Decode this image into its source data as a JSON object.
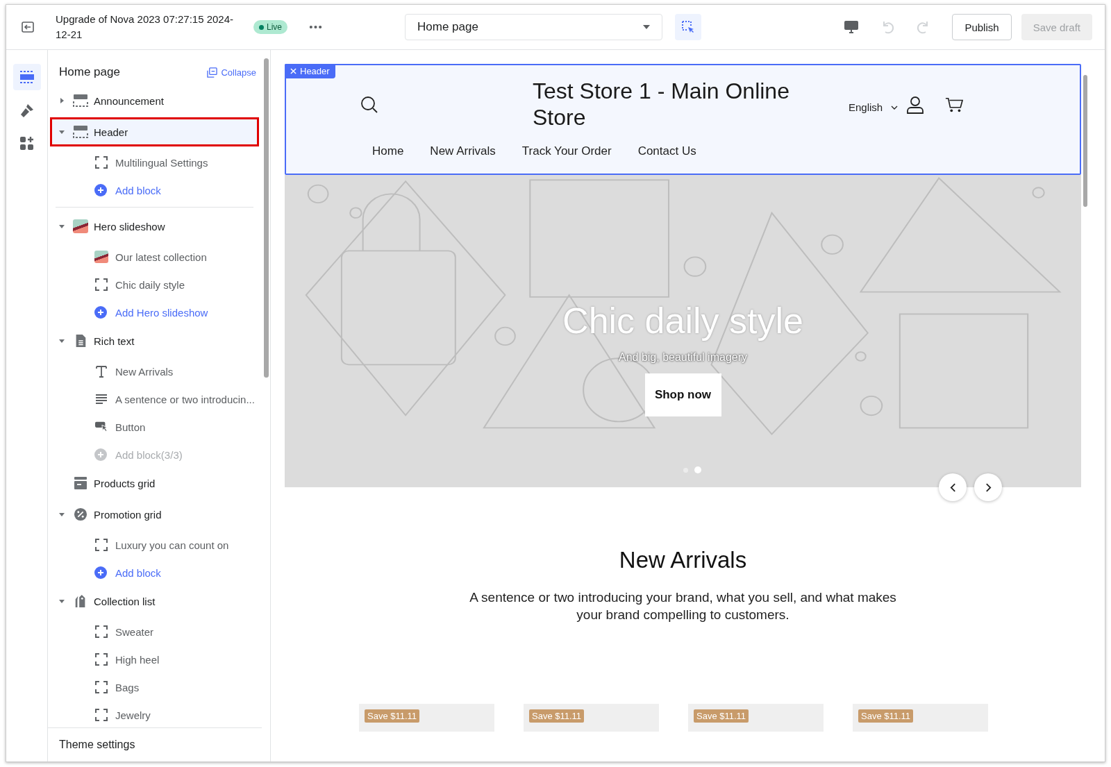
{
  "toolbar": {
    "title": "Upgrade of Nova 2023 07:27:15 2024-12-21",
    "status": "Live",
    "page_select": {
      "value": "Home page"
    },
    "inspect": {
      "selected": true
    },
    "undo": {
      "disabled": true
    },
    "redo": {
      "disabled": true
    },
    "publish": "Publish",
    "save_draft": {
      "label": "Save draft",
      "disabled": true
    }
  },
  "rail": [
    {
      "selected": true
    },
    {
      "selected": false
    },
    {
      "selected": false
    }
  ],
  "sidebar": {
    "title": "Home page",
    "collapse": "Collapse",
    "footer": "Theme settings",
    "sections": [
      {
        "label": "Announcement",
        "kind": "layout",
        "expanded": false,
        "selected": false
      },
      {
        "label": "Header",
        "kind": "layout",
        "expanded": true,
        "selected": true,
        "children": [
          {
            "label": "Multilingual Settings",
            "kind": "frame"
          },
          {
            "label": "Add block",
            "kind": "add",
            "disabled": false
          }
        ]
      },
      {
        "label": "Hero slideshow",
        "kind": "image",
        "expanded": true,
        "selected": false,
        "children": [
          {
            "label": "Our latest collection",
            "kind": "image"
          },
          {
            "label": "Chic daily style",
            "kind": "frame"
          },
          {
            "label": "Add Hero slideshow",
            "kind": "add",
            "disabled": false
          }
        ]
      },
      {
        "label": "Rich text",
        "kind": "document",
        "expanded": true,
        "selected": false,
        "children": [
          {
            "label": "New Arrivals",
            "kind": "text"
          },
          {
            "label": "A sentence or two introducin...",
            "kind": "lines"
          },
          {
            "label": "Button",
            "kind": "button"
          },
          {
            "label": "Add block(3/3)",
            "kind": "add",
            "disabled": true
          }
        ]
      },
      {
        "label": "Products grid",
        "kind": "archive",
        "selected": false
      },
      {
        "label": "Promotion grid",
        "kind": "percent",
        "expanded": true,
        "selected": false,
        "children": [
          {
            "label": "Luxury you can count on",
            "kind": "frame"
          },
          {
            "label": "Add block",
            "kind": "add",
            "disabled": false
          }
        ]
      },
      {
        "label": "Collection list",
        "kind": "tag",
        "expanded": true,
        "selected": false,
        "children": [
          {
            "label": "Sweater",
            "kind": "frame"
          },
          {
            "label": "High heel",
            "kind": "frame"
          },
          {
            "label": "Bags",
            "kind": "frame"
          },
          {
            "label": "Jewelry",
            "kind": "frame"
          }
        ]
      }
    ]
  },
  "preview": {
    "selection_label": "Header",
    "store_name": "Test Store 1 - Main Online Store",
    "language": "English",
    "nav": [
      "Home",
      "New Arrivals",
      "Track Your Order",
      "Contact Us"
    ],
    "hero": {
      "title": "Chic daily style",
      "subtitle": "And big, beautiful imagery",
      "button": "Shop now",
      "dots": [
        {
          "selected": false
        },
        {
          "selected": true
        }
      ]
    },
    "rich_text": {
      "heading": "New Arrivals",
      "body": "A sentence or two introducing your brand, what you sell, and what makes your brand compelling to customers."
    },
    "products": [
      {
        "badge": "Save $11.11"
      },
      {
        "badge": "Save $11.11"
      },
      {
        "badge": "Save $11.11"
      },
      {
        "badge": "Save $11.11"
      }
    ]
  }
}
